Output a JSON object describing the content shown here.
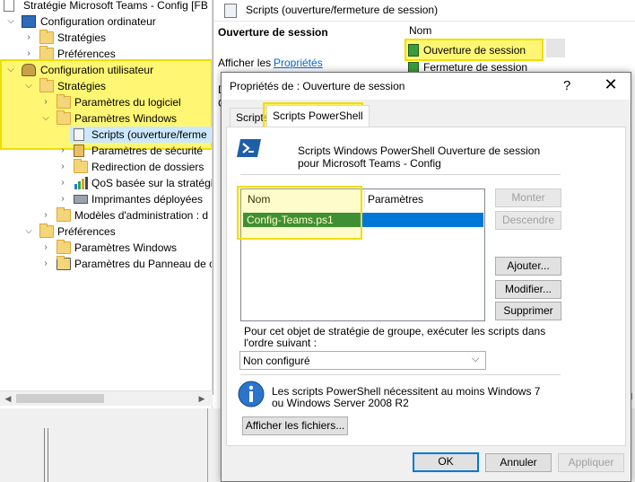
{
  "tree": {
    "root": "Stratégie Microsoft Teams - Config [FB",
    "items": [
      {
        "label": "Configuration ordinateur"
      },
      {
        "label": "Stratégies"
      },
      {
        "label": "Préférences"
      },
      {
        "label": "Configuration utilisateur"
      },
      {
        "label": "Stratégies"
      },
      {
        "label": "Paramètres du logiciel"
      },
      {
        "label": "Paramètres Windows"
      },
      {
        "label": "Scripts (ouverture/ferme"
      },
      {
        "label": "Paramètres de sécurité"
      },
      {
        "label": "Redirection de dossiers"
      },
      {
        "label": "QoS basée sur la stratégi"
      },
      {
        "label": "Imprimantes déployées"
      },
      {
        "label": "Modèles d'administration : d"
      },
      {
        "label": "Préférences"
      },
      {
        "label": "Paramètres Windows"
      },
      {
        "label": "Paramètres du Panneau de c"
      }
    ]
  },
  "scripts_window": {
    "title": "Scripts (ouverture/fermeture de session)",
    "heading": "Ouverture de session",
    "show_label": "Afficher les",
    "properties_link": "Propriétés",
    "column_name": "Nom",
    "list_items": [
      "Ouverture de session",
      "Fermeture de session"
    ],
    "desc_fragments": [
      "D",
      "C"
    ]
  },
  "dialog": {
    "title": "Propriétés de : Ouverture de session",
    "help": "?",
    "close": "✕",
    "tabs": [
      "Scripts",
      "Scripts PowerShell"
    ],
    "description": "Scripts Windows PowerShell Ouverture de session pour Microsoft Teams - Config",
    "list_columns": [
      "Nom",
      "Paramètres"
    ],
    "list_rows": [
      {
        "name": "Config-Teams.ps1",
        "params": ""
      }
    ],
    "buttons": {
      "up": "Monter",
      "down": "Descendre",
      "add": "Ajouter...",
      "edit": "Modifier...",
      "delete": "Supprimer",
      "show_files": "Afficher les fichiers...",
      "ok": "OK",
      "cancel": "Annuler",
      "apply": "Appliquer"
    },
    "order_label": "Pour cet objet de stratégie de groupe, exécuter les scripts dans l'ordre suivant :",
    "order_value": "Non configuré",
    "info_text": "Les scripts PowerShell nécessitent au moins Windows 7 ou Windows Server 2008 R2"
  },
  "colors": {
    "highlight": "#ffef00",
    "selection": "#0078d7",
    "selection_green": "#10793f"
  }
}
